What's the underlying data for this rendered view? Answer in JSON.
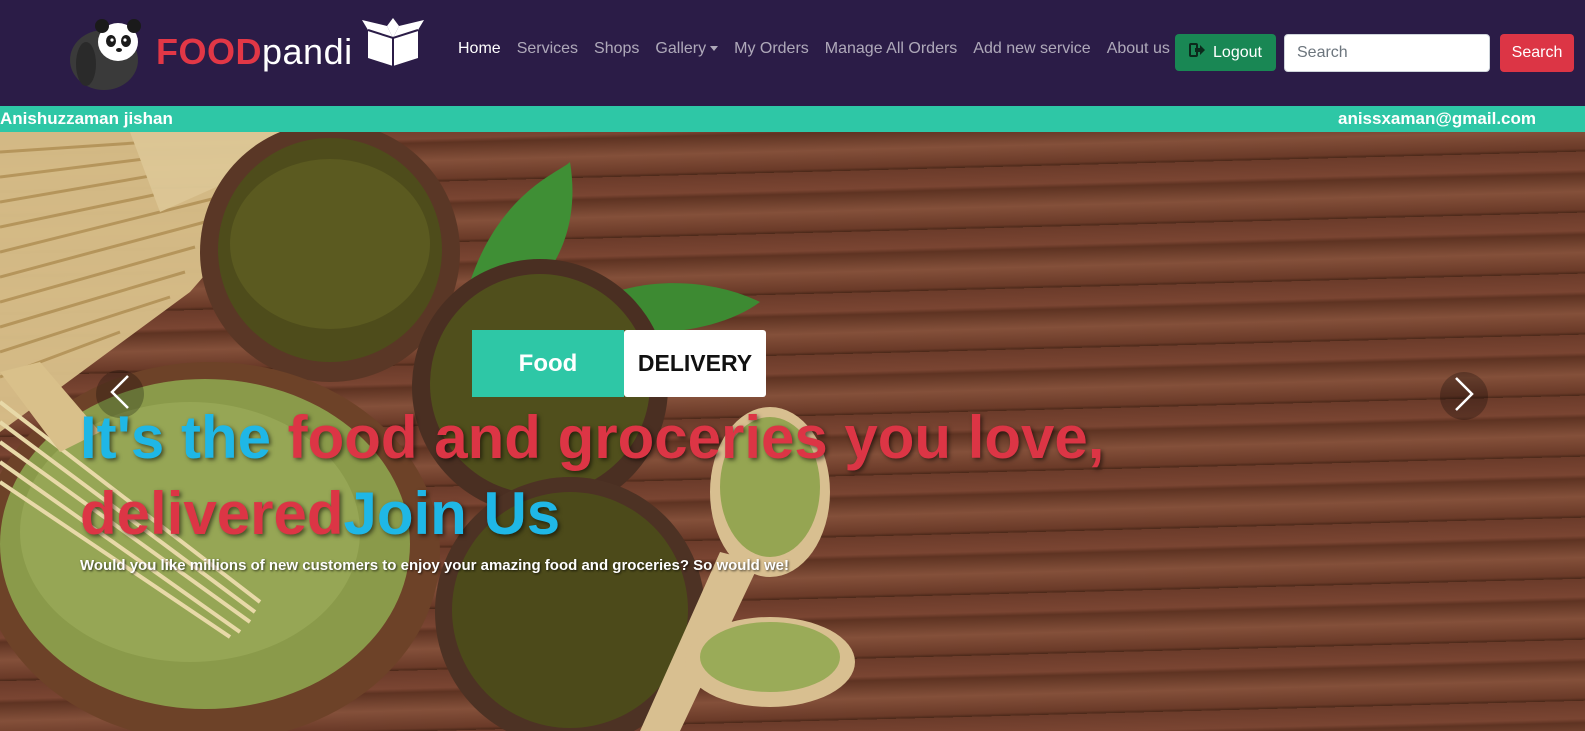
{
  "brand": {
    "name_part1": "FOOD",
    "name_part2": "pandi",
    "logo_icon": "panda-icon",
    "box_icon": "open-box-icon"
  },
  "nav": {
    "links": [
      {
        "label": "Home",
        "active": true
      },
      {
        "label": "Services",
        "active": false
      },
      {
        "label": "Shops",
        "active": false
      },
      {
        "label": "Gallery",
        "active": false,
        "dropdown": true
      },
      {
        "label": "My Orders",
        "active": false
      },
      {
        "label": "Manage All Orders",
        "active": false
      },
      {
        "label": "Add new service",
        "active": false
      },
      {
        "label": "About us",
        "active": false
      }
    ],
    "logout_label": "Logout",
    "search_placeholder": "Search",
    "search_button": "Search"
  },
  "user": {
    "name": "Anishuzzaman jishan",
    "email": "anissxaman@gmail.com"
  },
  "hero": {
    "tab_food": "Food",
    "tab_delivery": "DELIVERY",
    "headline_part1": "It's the ",
    "headline_part2": "food and groceries you love, delivered",
    "headline_part3": "Join Us",
    "subtitle": "Would you like millions of new customers to enjoy your amazing food and groceries? So would we!"
  },
  "colors": {
    "navbar_bg": "#2b1c47",
    "accent_teal": "#2ec7a6",
    "brand_red": "#e23746",
    "logout_green": "#198754",
    "search_red": "#dc3545",
    "headline_blue": "#1fb7e6",
    "headline_red": "#dc3545"
  }
}
